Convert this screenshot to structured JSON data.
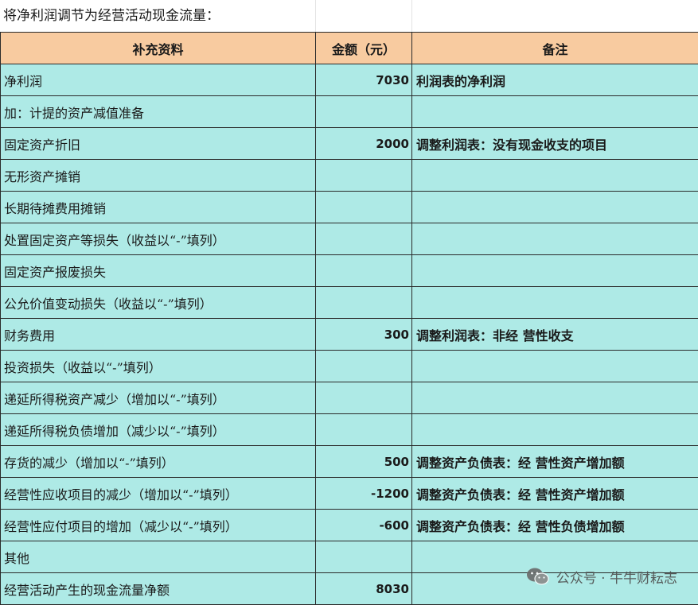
{
  "title": "将净利润调节为经营活动现金流量：",
  "table": {
    "headers": [
      "补充资料",
      "金额（元）",
      "备注"
    ],
    "rows": [
      {
        "label": "净利润",
        "amount": "7030",
        "note": "利润表的净利润"
      },
      {
        "label": "加：计提的资产减值准备",
        "amount": "",
        "note": ""
      },
      {
        "label": "固定资产折旧",
        "amount": "2000",
        "note": "调整利润表：没有现金收支的项目"
      },
      {
        "label": "无形资产摊销",
        "amount": "",
        "note": ""
      },
      {
        "label": "长期待摊费用摊销",
        "amount": "",
        "note": ""
      },
      {
        "label": "处置固定资产等损失（收益以“-”填列）",
        "amount": "",
        "note": ""
      },
      {
        "label": "固定资产报废损失",
        "amount": "",
        "note": ""
      },
      {
        "label": "公允价值变动损失（收益以“-”填列）",
        "amount": "",
        "note": ""
      },
      {
        "label": "财务费用",
        "amount": "300",
        "note": "调整利润表：非经 营性收支"
      },
      {
        "label": "投资损失（收益以“-”填列）",
        "amount": "",
        "note": ""
      },
      {
        "label": "递延所得税资产减少（增加以“-”填列）",
        "amount": "",
        "note": ""
      },
      {
        "label": "递延所得税负债增加（减少以“-”填列）",
        "amount": "",
        "note": ""
      },
      {
        "label": "存货的减少（增加以“-”填列）",
        "amount": "500",
        "note": "调整资产负债表：经 营性资产增加额"
      },
      {
        "label": "经营性应收项目的减少（增加以“-”填列）",
        "amount": "-1200",
        "note": "调整资产负债表：经 营性资产增加额"
      },
      {
        "label": "经营性应付项目的增加（减少以“-”填列）",
        "amount": "-600",
        "note": "调整资产负债表：经 营性负债增加额"
      },
      {
        "label": "其他",
        "amount": "",
        "note": ""
      },
      {
        "label": "经营活动产生的现金流量净额",
        "amount": "8030",
        "note": ""
      }
    ]
  },
  "watermark": {
    "text": "公众号 · 牛牛财耘志",
    "icon": "wechat-icon"
  },
  "colors": {
    "header_bg": "#f8cba0",
    "row_bg": "#aeeae6",
    "border": "#2a2a2a"
  }
}
